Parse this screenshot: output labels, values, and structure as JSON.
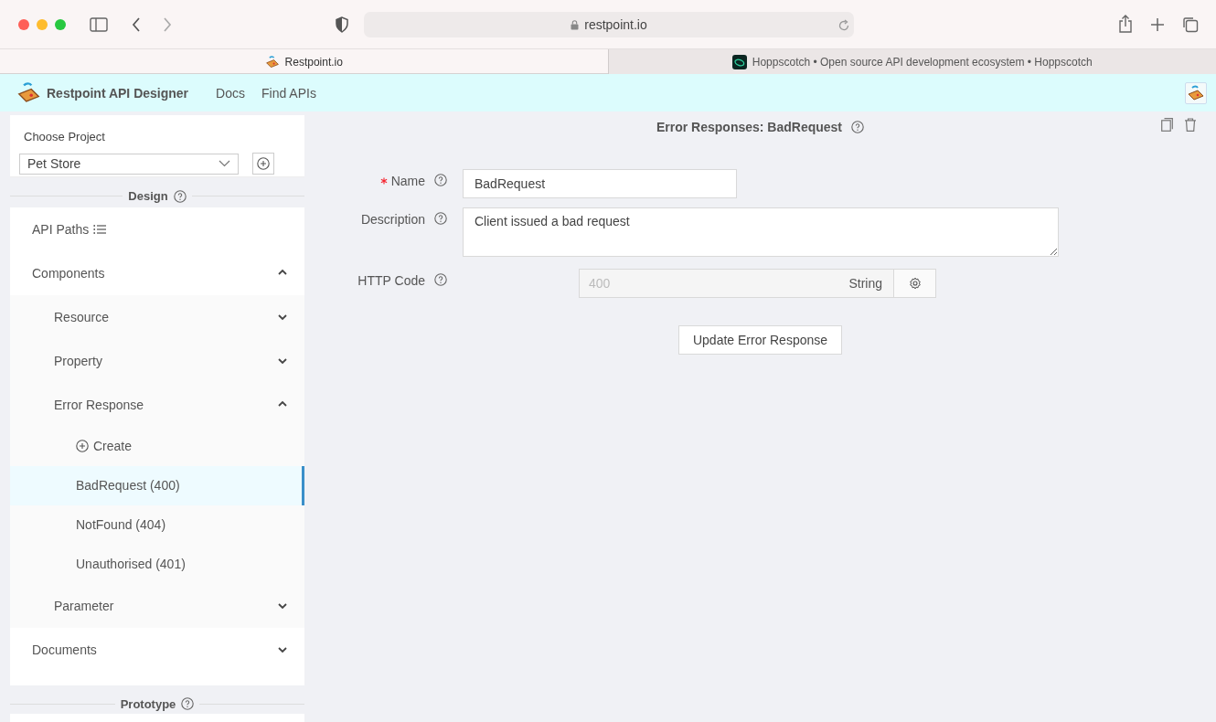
{
  "browser": {
    "url": "restpoint.io",
    "tabs": [
      {
        "title": "Restpoint.io",
        "selected": true
      },
      {
        "title": "Hoppscotch • Open source API development ecosystem • Hoppscotch",
        "selected": false
      }
    ]
  },
  "app": {
    "title": "Restpoint API Designer",
    "nav": [
      "Docs",
      "Find APIs"
    ]
  },
  "sidebar": {
    "project_label": "Choose Project",
    "project": "Pet Store",
    "design_title": "Design",
    "prototype_title": "Prototype",
    "design_items": [
      {
        "kind": "link",
        "label": "API Paths"
      },
      {
        "kind": "group",
        "label": "Components",
        "expanded": true,
        "children": [
          {
            "kind": "group",
            "label": "Resource",
            "expanded": false
          },
          {
            "kind": "group",
            "label": "Property",
            "expanded": false
          },
          {
            "kind": "group",
            "label": "Error Response",
            "expanded": true,
            "children": [
              {
                "kind": "action",
                "label": "Create"
              },
              {
                "kind": "leaf",
                "label": "BadRequest (400)",
                "selected": true
              },
              {
                "kind": "leaf",
                "label": "NotFound (404)",
                "selected": false
              },
              {
                "kind": "leaf",
                "label": "Unauthorised (401)",
                "selected": false
              }
            ]
          },
          {
            "kind": "group",
            "label": "Parameter",
            "expanded": false
          }
        ]
      },
      {
        "kind": "group",
        "label": "Documents",
        "expanded": false
      }
    ]
  },
  "form": {
    "title": "Error Responses: BadRequest",
    "fields": [
      {
        "kind": "text",
        "label": "Name",
        "required": true,
        "value": "BadRequest"
      },
      {
        "kind": "textarea",
        "label": "Description",
        "required": false,
        "value": "Client issued a bad request"
      },
      {
        "kind": "typed",
        "label": "HTTP Code",
        "required": false,
        "placeholder": "400",
        "type": "String"
      }
    ],
    "submit": "Update Error Response"
  }
}
